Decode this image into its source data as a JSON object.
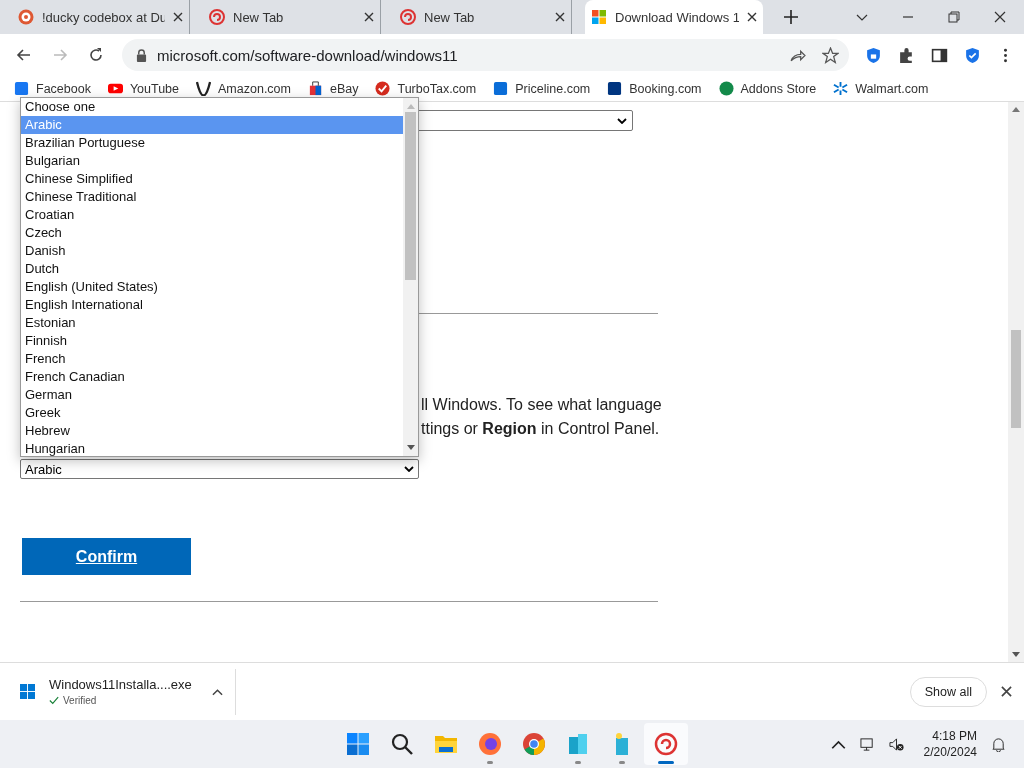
{
  "tabs": [
    {
      "title": "!ducky codebox at Du",
      "selected": false
    },
    {
      "title": "New Tab",
      "selected": false
    },
    {
      "title": "New Tab",
      "selected": false
    },
    {
      "title": "Download Windows 1",
      "selected": true
    }
  ],
  "address": "microsoft.com/software-download/windows11",
  "bookmarks": [
    {
      "label": "Facebook"
    },
    {
      "label": "YouTube"
    },
    {
      "label": "Amazon.com"
    },
    {
      "label": "eBay"
    },
    {
      "label": "TurboTax.com"
    },
    {
      "label": "Priceline.com"
    },
    {
      "label": "Booking.com"
    },
    {
      "label": "Addons Store"
    },
    {
      "label": "Walmart.com"
    }
  ],
  "paragraph": [
    "ll Windows. To see what language",
    "ttings or **Region** in Control Panel."
  ],
  "language_select": {
    "value": "Arabic"
  },
  "dropdown": {
    "options": [
      {
        "label": "Choose one",
        "selected": false
      },
      {
        "label": "Arabic",
        "selected": true
      },
      {
        "label": "Brazilian Portuguese",
        "selected": false
      },
      {
        "label": "Bulgarian",
        "selected": false
      },
      {
        "label": "Chinese Simplified",
        "selected": false
      },
      {
        "label": "Chinese Traditional",
        "selected": false
      },
      {
        "label": "Croatian",
        "selected": false
      },
      {
        "label": "Czech",
        "selected": false
      },
      {
        "label": "Danish",
        "selected": false
      },
      {
        "label": "Dutch",
        "selected": false
      },
      {
        "label": "English (United States)",
        "selected": false
      },
      {
        "label": "English International",
        "selected": false
      },
      {
        "label": "Estonian",
        "selected": false
      },
      {
        "label": "Finnish",
        "selected": false
      },
      {
        "label": "French",
        "selected": false
      },
      {
        "label": "French Canadian",
        "selected": false
      },
      {
        "label": "German",
        "selected": false
      },
      {
        "label": "Greek",
        "selected": false
      },
      {
        "label": "Hebrew",
        "selected": false
      },
      {
        "label": "Hungarian",
        "selected": false
      }
    ]
  },
  "confirm_button": "Confirm",
  "download": {
    "filename": "Windows11Installa....exe",
    "status": "Verified",
    "show_all": "Show all"
  },
  "taskbar": {
    "apps": [
      {
        "running": false,
        "active": false
      },
      {
        "running": false,
        "active": false
      },
      {
        "running": false,
        "active": false
      },
      {
        "running": true,
        "active": false
      },
      {
        "running": false,
        "active": false
      },
      {
        "running": true,
        "active": false
      },
      {
        "running": true,
        "active": false
      },
      {
        "running": true,
        "active": true
      }
    ],
    "time": "4:18 PM",
    "date": "2/20/2024"
  }
}
